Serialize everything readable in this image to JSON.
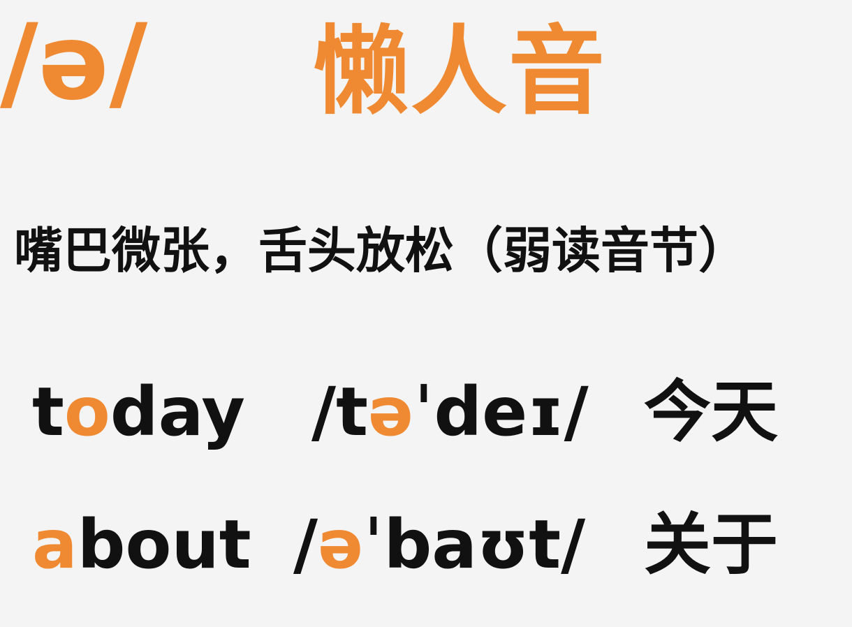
{
  "colors": {
    "accent": "#f08a32",
    "text": "#111111",
    "background": "#f4f4f4"
  },
  "header": {
    "symbol": "/ə/",
    "title": "懒人音"
  },
  "instruction": "嘴巴微张，舌头放松（弱读音节）",
  "examples": [
    {
      "word_parts": [
        {
          "text": "t",
          "highlight": false
        },
        {
          "text": "o",
          "highlight": true
        },
        {
          "text": "day",
          "highlight": false
        }
      ],
      "phonetic_parts": [
        {
          "text": "/t",
          "highlight": false
        },
        {
          "text": "ə",
          "highlight": true
        },
        {
          "text": "ˈdeɪ/",
          "highlight": false
        }
      ],
      "meaning": "今天"
    },
    {
      "word_parts": [
        {
          "text": "a",
          "highlight": true
        },
        {
          "text": "bout",
          "highlight": false
        }
      ],
      "phonetic_parts": [
        {
          "text": "/",
          "highlight": false
        },
        {
          "text": "ə",
          "highlight": true
        },
        {
          "text": "ˈbaʊt/",
          "highlight": false
        }
      ],
      "meaning": "关于"
    }
  ]
}
